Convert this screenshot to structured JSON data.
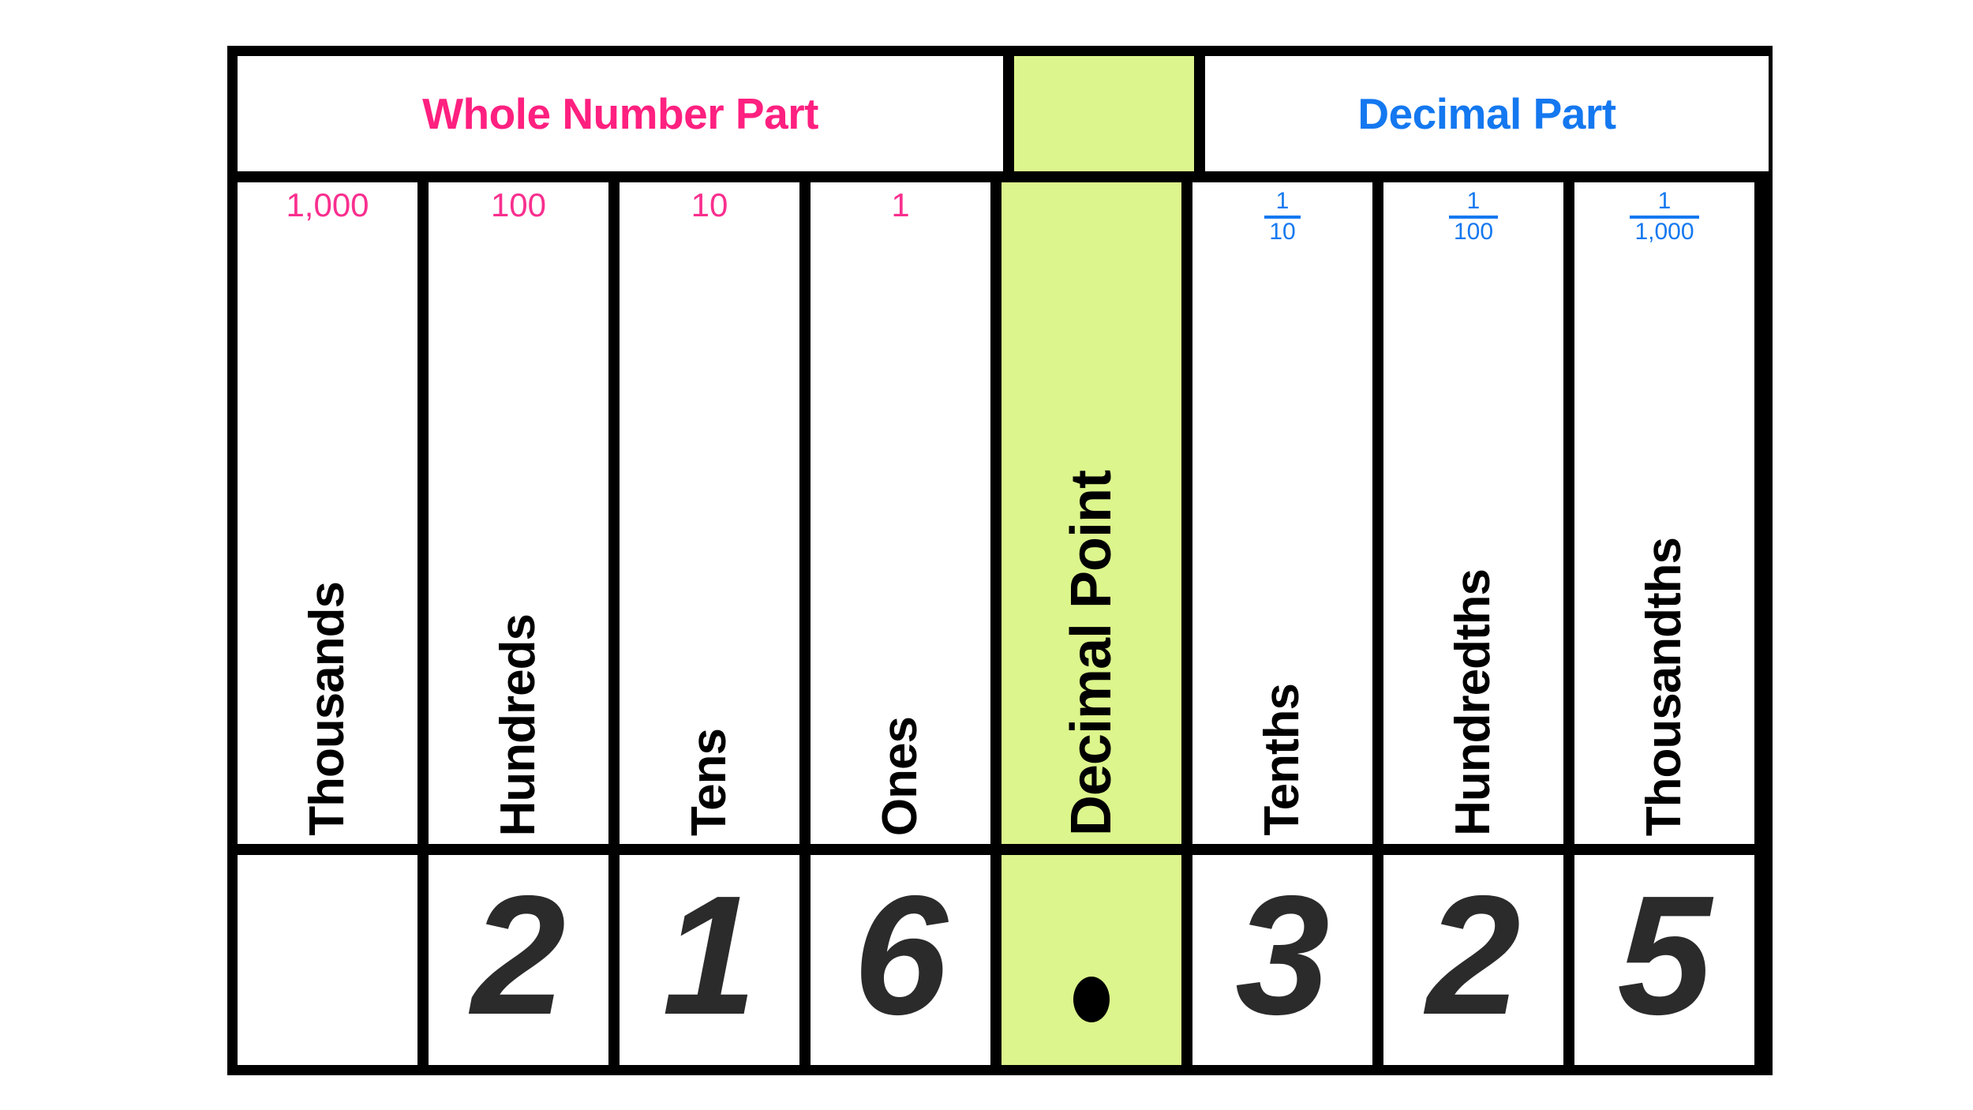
{
  "groups": [
    {
      "id": "whole",
      "label": "Whole Number Part",
      "color": "#ff2080"
    },
    {
      "id": "decimal",
      "label": "Decimal Part",
      "color": "#1478f0"
    }
  ],
  "highlight_color": "#dcf58c",
  "digit_color": "#2b2b2b",
  "columns": [
    {
      "name": "Thousands",
      "value_label": "1,000",
      "value_type": "whole",
      "digit": ""
    },
    {
      "name": "Hundreds",
      "value_label": "100",
      "value_type": "whole",
      "digit": "2"
    },
    {
      "name": "Tens",
      "value_label": "10",
      "value_type": "whole",
      "digit": "1"
    },
    {
      "name": "Ones",
      "value_label": "1",
      "value_type": "whole",
      "digit": "6"
    },
    {
      "name": "Decimal Point",
      "value_label": "",
      "value_type": "point",
      "digit": "."
    },
    {
      "name": "Tenths",
      "value_label": "1/10",
      "value_type": "fraction",
      "numerator": "1",
      "denominator": "10",
      "digit": "3"
    },
    {
      "name": "Hundredths",
      "value_label": "1/100",
      "value_type": "fraction",
      "numerator": "1",
      "denominator": "100",
      "digit": "2"
    },
    {
      "name": "Thousandths",
      "value_label": "1/1,000",
      "value_type": "fraction",
      "numerator": "1",
      "denominator": "1,000",
      "digit": "5"
    }
  ],
  "number_shown": "216.325"
}
